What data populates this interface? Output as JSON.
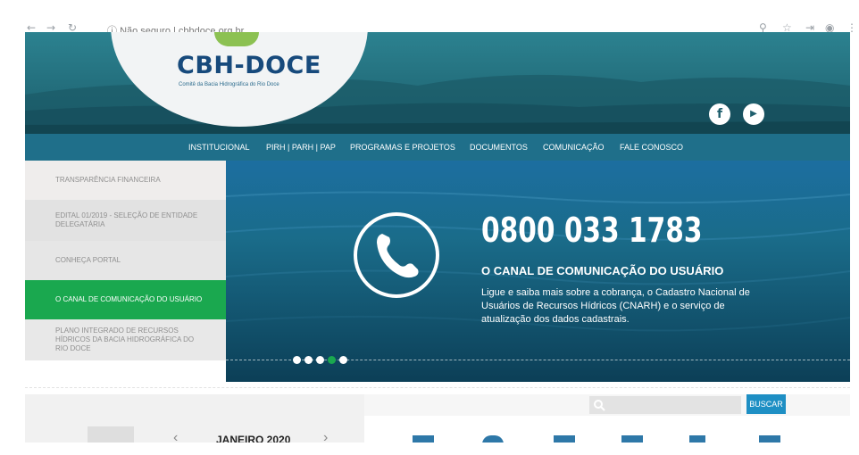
{
  "browser": {
    "back": "←",
    "forward": "→",
    "reload": "↻",
    "security": "Não seguro",
    "url": "cbhdoce.org.br"
  },
  "logo": {
    "title": "CBH-DOCE",
    "subtitle": "Comitê da Bacia Hidrográfica do Rio Doce"
  },
  "social": [
    {
      "icon": "facebook-icon",
      "glyph": "f"
    },
    {
      "icon": "youtube-icon",
      "glyph": "▶"
    }
  ],
  "nav": [
    {
      "label": "INSTITUCIONAL"
    },
    {
      "label": "PIRH | PARH | PAP"
    },
    {
      "label": "PROGRAMAS E PROJETOS"
    },
    {
      "label": "DOCUMENTOS"
    },
    {
      "label": "COMUNICAÇÃO"
    },
    {
      "label": "FALE CONOSCO"
    }
  ],
  "sidebar": [
    {
      "label": "TRANSPARÊNCIA FINANCEIRA",
      "active": false
    },
    {
      "label": "EDITAL 01/2019 - SELEÇÃO DE ENTIDADE DELEGATÁRIA",
      "active": false
    },
    {
      "label": "CONHEÇA PORTAL",
      "active": false
    },
    {
      "label": "O CANAL DE COMUNICAÇÃO DO USUÁRIO",
      "active": true
    },
    {
      "label": "PLANO INTEGRADO DE RECURSOS HÍDRICOS DA BACIA HIDROGRÁFICA DO RIO DOCE",
      "active": false
    }
  ],
  "banner": {
    "phone": "0800 033 1783",
    "subtitle": "O CANAL DE COMUNICAÇÃO DO USUÁRIO",
    "description": "Ligue e saiba mais sobre a cobrança, o Cadastro Nacional de Usuários de Recursos Hídricos (CNARH) e o serviço de atualização dos dados cadastrais.",
    "dots_total": 5,
    "dots_active": 4
  },
  "calendar": {
    "prev": "‹",
    "next": "›",
    "month": "JANEIRO 2020"
  },
  "search": {
    "placeholder": "",
    "button": "BUSCAR"
  },
  "colors": {
    "nav_bg": "#1f6f8a",
    "active_green": "#1aa84f",
    "logo_blue": "#174a7c",
    "buscar_blue": "#1e8fc4"
  }
}
